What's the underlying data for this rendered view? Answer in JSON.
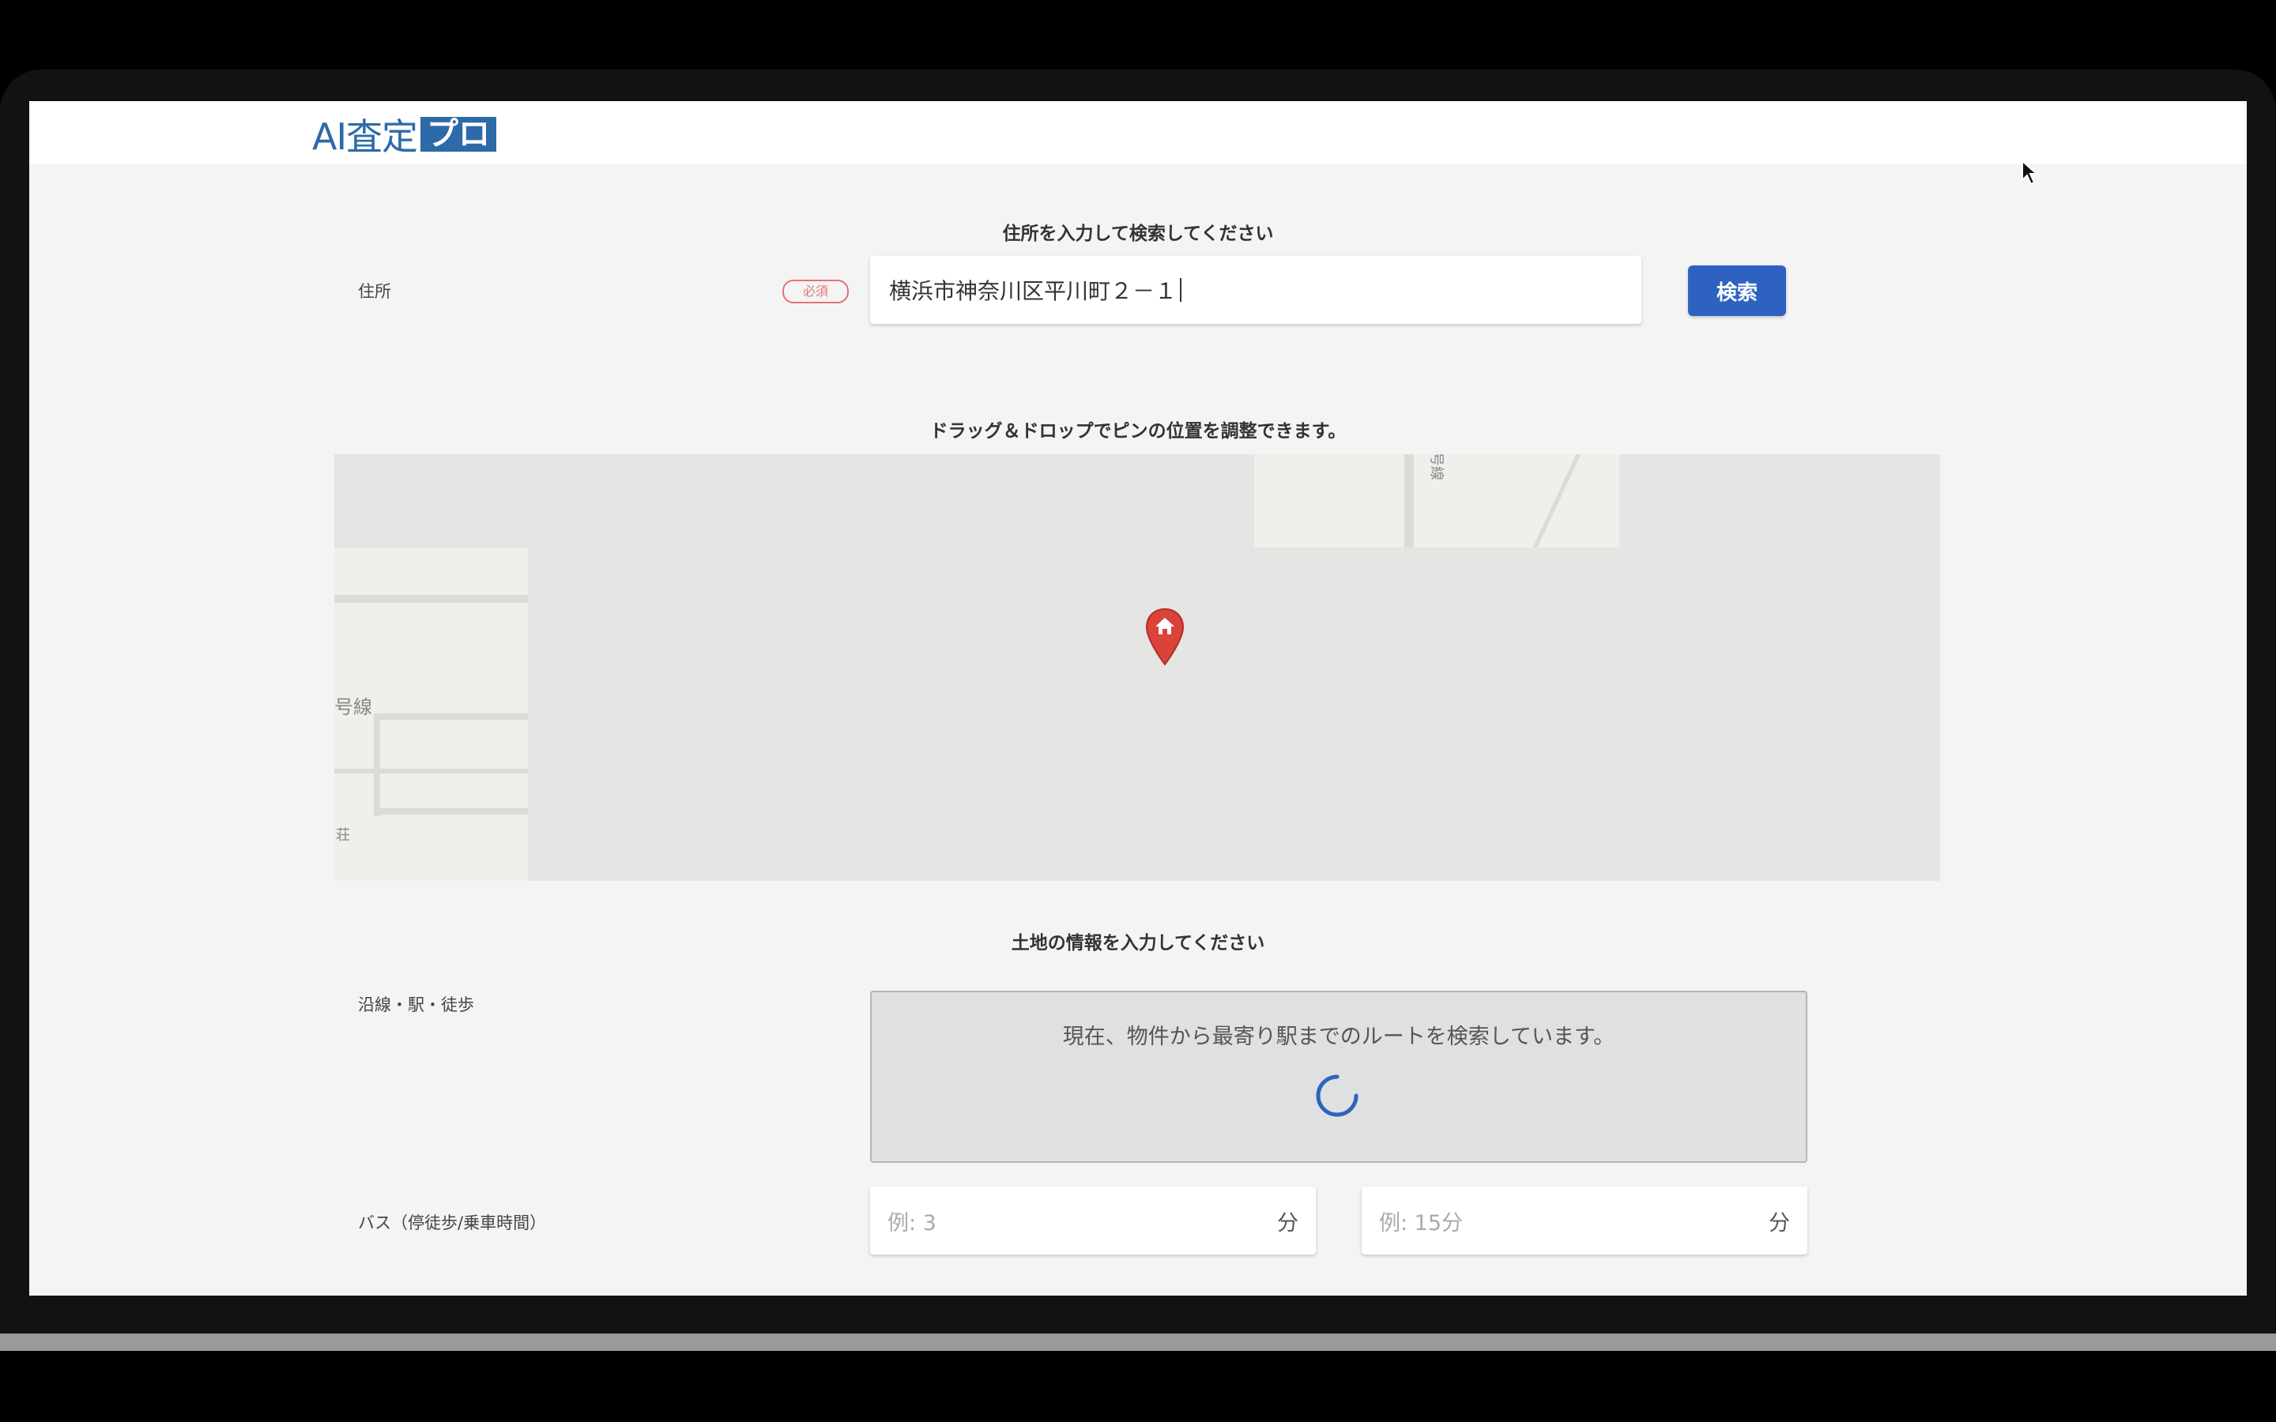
{
  "app": {
    "logo_text": "AI査定",
    "logo_box": "プロ"
  },
  "address_section": {
    "title": "住所を入力して検索してください",
    "label": "住所",
    "required": "必須",
    "value": "横浜市神奈川区平川町２－１",
    "search_label": "検索"
  },
  "map_section": {
    "title": "ドラッグ＆ドロップでピンの位置を調整できます。",
    "map_labels": [
      "号線",
      "荘",
      "号線"
    ]
  },
  "land_section": {
    "title": "土地の情報を入力してください",
    "route_label": "沿線・駅・徒歩",
    "route_message": "現在、物件から最寄り駅までのルートを検索しています。",
    "bus_label": "バス（停徒歩/乗車時間）",
    "bus_walk_placeholder": "例: 3",
    "bus_walk_unit": "分",
    "bus_ride_placeholder": "例: 15分",
    "bus_ride_unit": "分"
  },
  "colors": {
    "accent": "#2e62c0",
    "logo": "#2d6aa8",
    "required": "#e57373",
    "pin": "#d9433a"
  },
  "icons": {
    "pin": "map-pin-house-icon",
    "spinner": "loading-spinner-icon",
    "cursor": "mouse-cursor-icon"
  }
}
